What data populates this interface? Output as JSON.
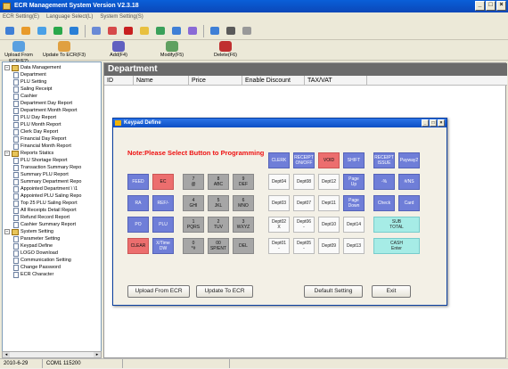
{
  "window": {
    "title": "ECR Management System  Version V2.3.18"
  },
  "menu": [
    "ECR Setting(E)",
    "Language Select(L)",
    "System Setting(S)"
  ],
  "toolbar1_icons": [
    "open-icon",
    "save-icon",
    "folder-icon",
    "globe-icon",
    "refresh-icon",
    "table-icon",
    "edit-icon",
    "delete-icon",
    "stop-icon",
    "export-icon",
    "chart-icon",
    "tools-icon",
    "ie-icon",
    "download-icon",
    "arrow-icon"
  ],
  "toolbar2": [
    {
      "label": "Upload From ECR(F2)",
      "icon": "upload-icon",
      "color": "#5aa0e0"
    },
    {
      "label": "Update To ECR(F3)",
      "icon": "update-icon",
      "color": "#e0a040"
    },
    {
      "label": "Add(F4)",
      "icon": "add-icon",
      "color": "#6060c0"
    },
    {
      "label": "Modify(F5)",
      "icon": "modify-icon",
      "color": "#60a060"
    },
    {
      "label": "Delete(F6)",
      "icon": "delete-icon",
      "color": "#c03030"
    }
  ],
  "tree": [
    {
      "label": "Data Management",
      "level": 0,
      "type": "folder"
    },
    {
      "label": "Department",
      "level": 1,
      "type": "doc"
    },
    {
      "label": "PLU Setting",
      "level": 1,
      "type": "doc"
    },
    {
      "label": "Saling Receipt",
      "level": 1,
      "type": "doc"
    },
    {
      "label": "Cashier",
      "level": 1,
      "type": "doc"
    },
    {
      "label": "Department Day Report",
      "level": 1,
      "type": "doc"
    },
    {
      "label": "Department Month Report",
      "level": 1,
      "type": "doc"
    },
    {
      "label": "PLU Day Report",
      "level": 1,
      "type": "doc"
    },
    {
      "label": "PLU Month Report",
      "level": 1,
      "type": "doc"
    },
    {
      "label": "Clerk Day Report",
      "level": 1,
      "type": "doc"
    },
    {
      "label": "Financial Day Report",
      "level": 1,
      "type": "doc"
    },
    {
      "label": "Financial Month Report",
      "level": 1,
      "type": "doc"
    },
    {
      "label": "Reports Statics",
      "level": 0,
      "type": "folder"
    },
    {
      "label": "PLU Shortage Report",
      "level": 1,
      "type": "doc"
    },
    {
      "label": "Transaction Summary Repo",
      "level": 1,
      "type": "doc"
    },
    {
      "label": "Summary PLU Report",
      "level": 1,
      "type": "doc"
    },
    {
      "label": "Summary Department Repo",
      "level": 1,
      "type": "doc"
    },
    {
      "label": "Appointed Department \\ \\1",
      "level": 1,
      "type": "doc"
    },
    {
      "label": "Appointed PLU Saling Repo",
      "level": 1,
      "type": "doc"
    },
    {
      "label": "Top 25 PLU Saling Report",
      "level": 1,
      "type": "doc"
    },
    {
      "label": "All Receipts Detail Report",
      "level": 1,
      "type": "doc"
    },
    {
      "label": "Refund Record Report",
      "level": 1,
      "type": "doc"
    },
    {
      "label": "Cashier Summary Report",
      "level": 1,
      "type": "doc"
    },
    {
      "label": "System Setting",
      "level": 0,
      "type": "folder"
    },
    {
      "label": "Parameter Setting",
      "level": 1,
      "type": "doc"
    },
    {
      "label": "Keypad Define",
      "level": 1,
      "type": "doc"
    },
    {
      "label": "LOGO Download",
      "level": 1,
      "type": "doc"
    },
    {
      "label": "Communication Setting",
      "level": 1,
      "type": "doc"
    },
    {
      "label": "Change Password",
      "level": 1,
      "type": "doc"
    },
    {
      "label": "ECR Character",
      "level": 1,
      "type": "doc"
    }
  ],
  "main": {
    "heading": "Department",
    "columns": [
      "ID",
      "Name",
      "Price",
      "Enable Discount",
      "TAX/VAT"
    ]
  },
  "dialog": {
    "title": "Keypad Define",
    "note": "Note:Please Select Button to Programming",
    "buttons": {
      "upload": "Upload From ECR",
      "update": "Update To ECR",
      "default": "Default Setting",
      "exit": "Exit"
    }
  },
  "keys": [
    {
      "label": "CLERK",
      "color": "blue"
    },
    {
      "label": "RECEIPT\nON/OFF",
      "color": "blue"
    },
    {
      "label": "VOID",
      "color": "red"
    },
    {
      "label": "SHIFT",
      "color": "blue"
    },
    {
      "label": "RECEIPT\nISSUE",
      "color": "blue"
    },
    {
      "label": "Payway2",
      "color": "blue"
    },
    {
      "label": "FEED",
      "color": "blue"
    },
    {
      "label": "EC",
      "color": "red"
    },
    {
      "label": "7\n@",
      "color": "gray"
    },
    {
      "label": "8\nABC",
      "color": "gray"
    },
    {
      "label": "9\nDEF",
      "color": "gray"
    },
    {
      "label": "Dept04",
      "color": "white"
    },
    {
      "label": "Dept08",
      "color": "white"
    },
    {
      "label": "Dept12",
      "color": "white"
    },
    {
      "label": "Page\nUp",
      "color": "blue"
    },
    {
      "label": "-%",
      "color": "blue"
    },
    {
      "label": "#/NS",
      "color": "blue"
    },
    {
      "label": "RA",
      "color": "blue"
    },
    {
      "label": "REF/-",
      "color": "blue"
    },
    {
      "label": "4\nGHI",
      "color": "gray"
    },
    {
      "label": "5\nJKL",
      "color": "gray"
    },
    {
      "label": "6\nMNO",
      "color": "gray"
    },
    {
      "label": "Dept03",
      "color": "white"
    },
    {
      "label": "Dept07",
      "color": "white"
    },
    {
      "label": "Dept11",
      "color": "white"
    },
    {
      "label": "Page\nDown",
      "color": "blue"
    },
    {
      "label": "Check",
      "color": "blue"
    },
    {
      "label": "Card",
      "color": "blue"
    },
    {
      "label": "PO",
      "color": "blue"
    },
    {
      "label": "PLU",
      "color": "blue"
    },
    {
      "label": "1\nPQRS",
      "color": "gray"
    },
    {
      "label": "2\nTUV",
      "color": "gray"
    },
    {
      "label": "3\nWXYZ",
      "color": "gray"
    },
    {
      "label": "Dept02\nX",
      "color": "white"
    },
    {
      "label": "Dept06\n-",
      "color": "white"
    },
    {
      "label": "Dept10",
      "color": "white"
    },
    {
      "label": "Dept14",
      "color": "white"
    },
    {
      "label": "SUB\nTOTAL",
      "color": "cyan"
    },
    {
      "label": "CLEAR",
      "color": "red"
    },
    {
      "label": "X/Time\nDW",
      "color": "blue"
    },
    {
      "label": "0\n*#",
      "color": "gray"
    },
    {
      "label": "00\nSP/ENT",
      "color": "gray"
    },
    {
      "label": "DEL",
      "color": "gray"
    },
    {
      "label": "Dept01\n-",
      "color": "white"
    },
    {
      "label": "Dept05\n-",
      "color": "white"
    },
    {
      "label": "Dept09",
      "color": "white"
    },
    {
      "label": "Dept13",
      "color": "white"
    },
    {
      "label": "CASH\nEnter",
      "color": "cyan"
    }
  ],
  "status": [
    "2010-6-29",
    "COM1 115200",
    "",
    ""
  ]
}
